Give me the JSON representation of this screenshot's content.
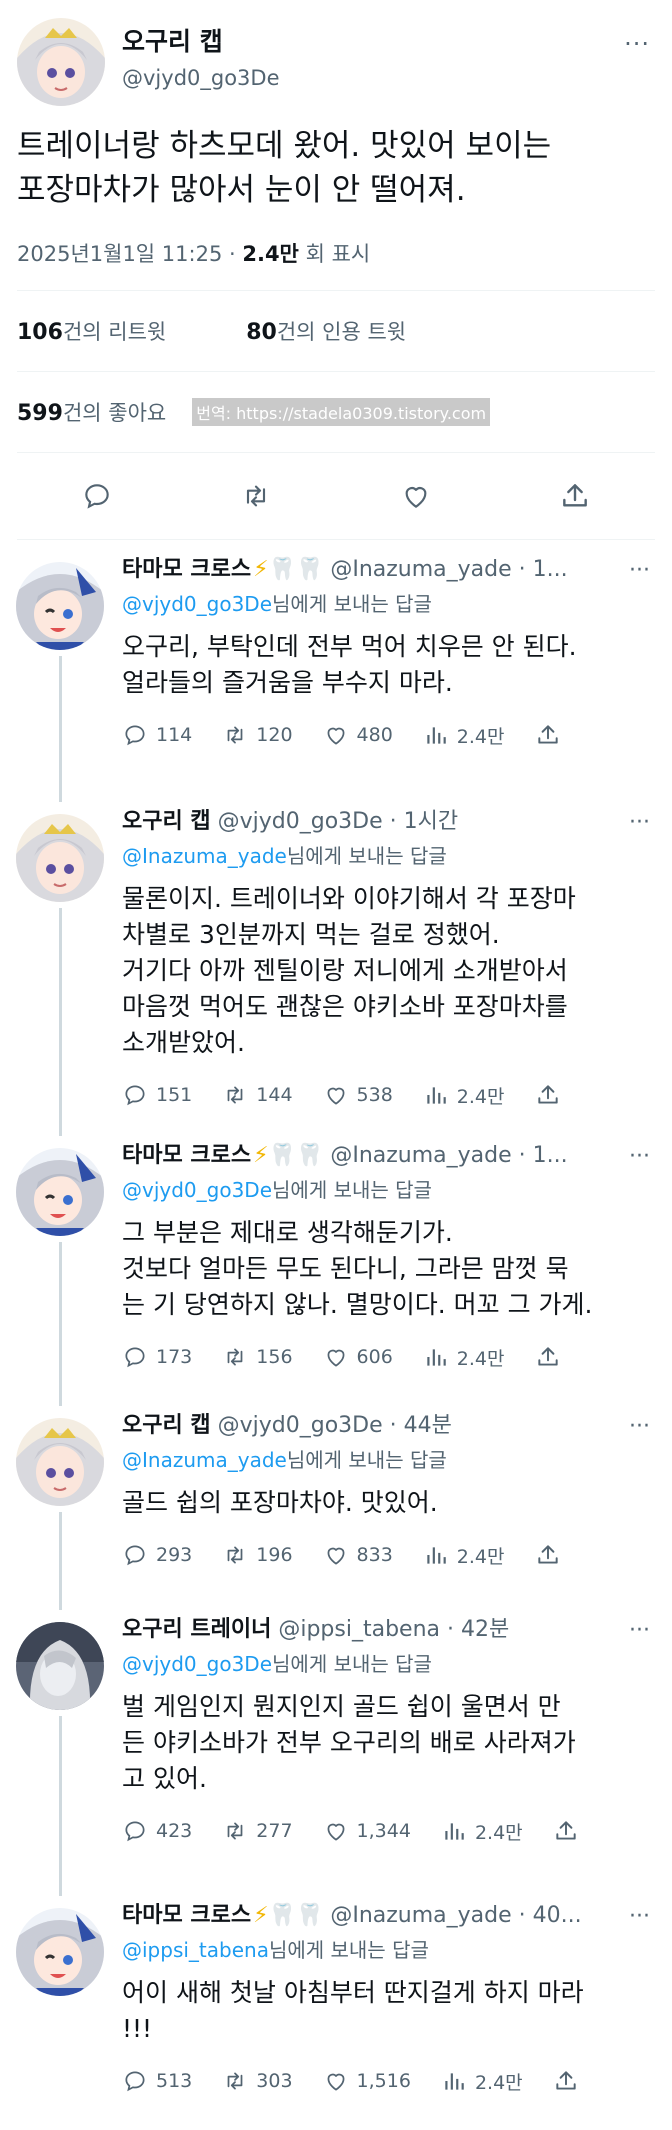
{
  "post": {
    "author": "오구리 캡",
    "handle": "@vjyd0_go3De",
    "text": "트레이너랑 하츠모데 왔어. 맛있어 보이는\n포장마차가 많아서 눈이 안 떨어져.",
    "date": "2025년1월1일 11:25 ·",
    "views": "2.4만",
    "views_label": "회 표시",
    "retweets": "106",
    "retweets_label": "건의 리트윗",
    "quotes": "80",
    "quotes_label": "건의 인용 트윗",
    "likes": "599",
    "likes_label": "건의 좋아요",
    "watermark": "번역: https://stadela0309.tistory.com"
  },
  "replies": [
    {
      "name": "타마모 크로스",
      "handle": "@Inazuma_yade · 1...",
      "reply_to": "@vjyd0_go3De",
      "reply_suffix": "님에게 보내는 답글",
      "text": "오구리, 부탁인데 전부 먹어 치우믄 안 된다.\n얼라들의 즐거움을 부수지 마라.",
      "replies": "114",
      "retweets": "120",
      "likes": "480",
      "views": "2.4만",
      "avatar": "tamamo"
    },
    {
      "name": "오구리 캡",
      "handle": "@vjyd0_go3De · 1시간",
      "reply_to": "@Inazuma_yade",
      "reply_suffix": "님에게 보내는 답글",
      "text": "물론이지. 트레이너와 이야기해서 각 포장마\n차별로 3인분까지 먹는 걸로 정했어.\n거기다 아까 젠틸이랑 저니에게 소개받아서\n마음껏 먹어도 괜찮은 야키소바 포장마차를\n소개받았어.",
      "replies": "151",
      "retweets": "144",
      "likes": "538",
      "views": "2.4만",
      "avatar": "oguri"
    },
    {
      "name": "타마모 크로스",
      "handle": "@Inazuma_yade · 1...",
      "reply_to": "@vjyd0_go3De",
      "reply_suffix": "님에게 보내는 답글",
      "text": "그 부분은 제대로 생각해둔기가.\n것보다 얼마든 무도 된다니, 그라믄 맘껏 묵\n는 기 당연하지 않나. 멸망이다. 머꼬 그 가게.",
      "replies": "173",
      "retweets": "156",
      "likes": "606",
      "views": "2.4만",
      "avatar": "tamamo"
    },
    {
      "name": "오구리 캡",
      "handle": "@vjyd0_go3De · 44분",
      "reply_to": "@Inazuma_yade",
      "reply_suffix": "님에게 보내는 답글",
      "text": "골드 쉽의 포장마차야. 맛있어.",
      "replies": "293",
      "retweets": "196",
      "likes": "833",
      "views": "2.4만",
      "avatar": "oguri"
    },
    {
      "name": "오구리 트레이너",
      "handle": "@ippsi_tabena · 42분",
      "reply_to": "@vjyd0_go3De",
      "reply_suffix": "님에게 보내는 답글",
      "text": "벌 게임인지 뭔지인지 골드 쉽이 울면서 만\n든 야키소바가 전부 오구리의 배로 사라져가\n고 있어.",
      "replies": "423",
      "retweets": "277",
      "likes": "1,344",
      "views": "2.4만",
      "avatar": "trainer"
    },
    {
      "name": "타마모 크로스",
      "handle": "@Inazuma_yade · 40...",
      "reply_to": "@ippsi_tabena",
      "reply_suffix": "님에게 보내는 답글",
      "text": "어이 새해 첫날 아침부터 딴지걸게 하지 마라\n!!!",
      "replies": "513",
      "retweets": "303",
      "likes": "1,516",
      "views": "2.4만",
      "avatar": "tamamo"
    }
  ],
  "more_label": "···",
  "badge_emoji": "⚡🦷🦷"
}
